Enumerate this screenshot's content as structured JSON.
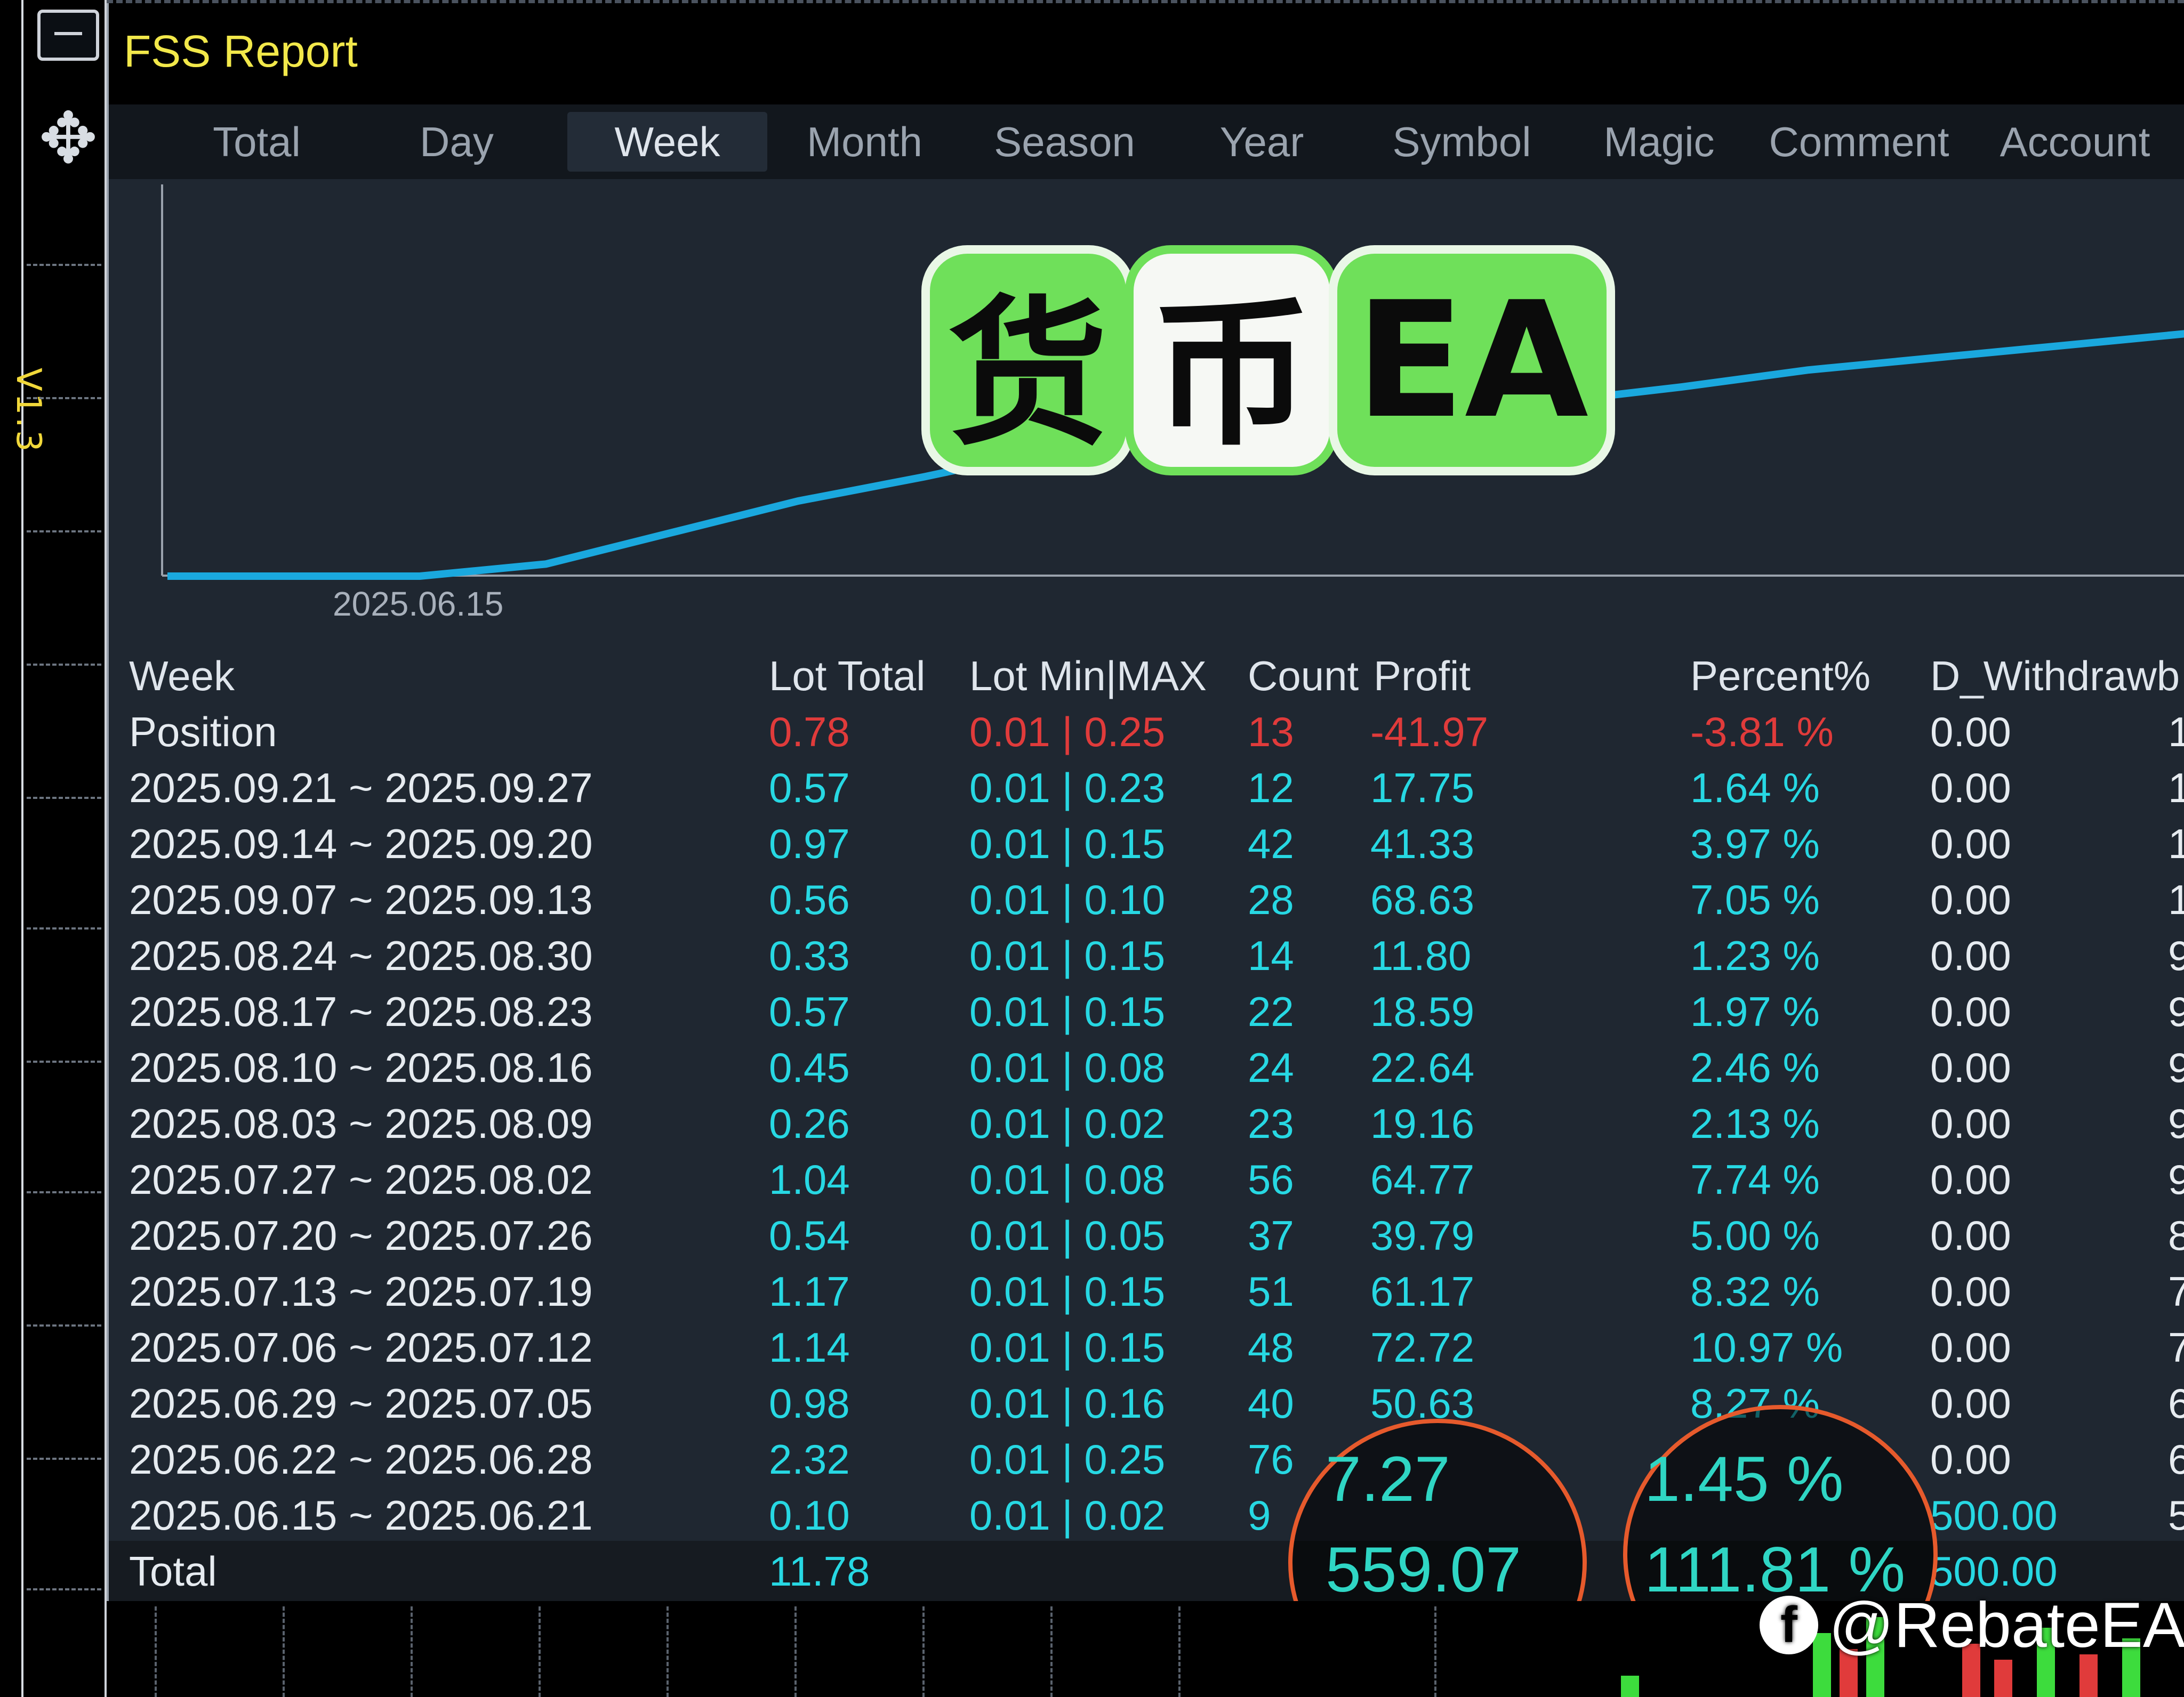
{
  "window": {
    "title": "FSS Report",
    "version_label": "V1.3"
  },
  "tabs": [
    {
      "label": "Total",
      "active": false
    },
    {
      "label": "Day",
      "active": false
    },
    {
      "label": "Week",
      "active": true
    },
    {
      "label": "Month",
      "active": false
    },
    {
      "label": "Season",
      "active": false
    },
    {
      "label": "Year",
      "active": false
    },
    {
      "label": "Symbol",
      "active": false
    },
    {
      "label": "Magic",
      "active": false
    },
    {
      "label": "Comment",
      "active": false
    },
    {
      "label": "Account",
      "active": false
    }
  ],
  "chart_data": {
    "type": "line",
    "x_start_label": "2025.06.15",
    "series": [
      {
        "color": "#1aa8de",
        "values": [
          0,
          0,
          0,
          0.05,
          0.18,
          0.31,
          0.41,
          0.52,
          0.58,
          0.62,
          0.67,
          0.72,
          0.78,
          0.85,
          0.9,
          0.95,
          1.0
        ]
      }
    ]
  },
  "overlay_stamp": {
    "text_1": "货",
    "text_2": "币",
    "text_3": "EA"
  },
  "table": {
    "headers": [
      "Week",
      "Lot Total",
      "Lot Min|MAX",
      "Count",
      "Profit",
      "Percent%",
      "D_Withdrawb"
    ],
    "position_row": {
      "label": "Position",
      "lot_total": "0.78",
      "lot_minmax": "0.01 | 0.25",
      "count": "13",
      "profit": "-41.97",
      "percent": "-3.81 %",
      "withdraw": "0.00",
      "last": "1"
    },
    "rows": [
      {
        "week": "2025.09.21 ~ 2025.09.27",
        "lot_total": "0.57",
        "lot_minmax": "0.01 | 0.23",
        "count": "12",
        "profit": "17.75",
        "percent": "1.64 %",
        "withdraw": "0.00",
        "last": "1"
      },
      {
        "week": "2025.09.14 ~ 2025.09.20",
        "lot_total": "0.97",
        "lot_minmax": "0.01 | 0.15",
        "count": "42",
        "profit": "41.33",
        "percent": "3.97 %",
        "withdraw": "0.00",
        "last": "1"
      },
      {
        "week": "2025.09.07 ~ 2025.09.13",
        "lot_total": "0.56",
        "lot_minmax": "0.01 | 0.10",
        "count": "28",
        "profit": "68.63",
        "percent": "7.05 %",
        "withdraw": "0.00",
        "last": "1"
      },
      {
        "week": "2025.08.24 ~ 2025.08.30",
        "lot_total": "0.33",
        "lot_minmax": "0.01 | 0.15",
        "count": "14",
        "profit": "11.80",
        "percent": "1.23 %",
        "withdraw": "0.00",
        "last": "9"
      },
      {
        "week": "2025.08.17 ~ 2025.08.23",
        "lot_total": "0.57",
        "lot_minmax": "0.01 | 0.15",
        "count": "22",
        "profit": "18.59",
        "percent": "1.97 %",
        "withdraw": "0.00",
        "last": "9"
      },
      {
        "week": "2025.08.10 ~ 2025.08.16",
        "lot_total": "0.45",
        "lot_minmax": "0.01 | 0.08",
        "count": "24",
        "profit": "22.64",
        "percent": "2.46 %",
        "withdraw": "0.00",
        "last": "9"
      },
      {
        "week": "2025.08.03 ~ 2025.08.09",
        "lot_total": "0.26",
        "lot_minmax": "0.01 | 0.02",
        "count": "23",
        "profit": "19.16",
        "percent": "2.13 %",
        "withdraw": "0.00",
        "last": "9"
      },
      {
        "week": "2025.07.27 ~ 2025.08.02",
        "lot_total": "1.04",
        "lot_minmax": "0.01 | 0.08",
        "count": "56",
        "profit": "64.77",
        "percent": "7.74 %",
        "withdraw": "0.00",
        "last": "9"
      },
      {
        "week": "2025.07.20 ~ 2025.07.26",
        "lot_total": "0.54",
        "lot_minmax": "0.01 | 0.05",
        "count": "37",
        "profit": "39.79",
        "percent": "5.00 %",
        "withdraw": "0.00",
        "last": "8"
      },
      {
        "week": "2025.07.13 ~ 2025.07.19",
        "lot_total": "1.17",
        "lot_minmax": "0.01 | 0.15",
        "count": "51",
        "profit": "61.17",
        "percent": "8.32 %",
        "withdraw": "0.00",
        "last": "7"
      },
      {
        "week": "2025.07.06 ~ 2025.07.12",
        "lot_total": "1.14",
        "lot_minmax": "0.01 | 0.15",
        "count": "48",
        "profit": "72.72",
        "percent": "10.97 %",
        "withdraw": "0.00",
        "last": "7"
      },
      {
        "week": "2025.06.29 ~ 2025.07.05",
        "lot_total": "0.98",
        "lot_minmax": "0.01 | 0.16",
        "count": "40",
        "profit": "50.63",
        "percent": "8.27 %",
        "withdraw": "0.00",
        "last": "6"
      },
      {
        "week": "2025.06.22 ~ 2025.06.28",
        "lot_total": "2.32",
        "lot_minmax": "0.01 | 0.25",
        "count": "76",
        "profit": "7.27",
        "percent": "1.45 %",
        "withdraw": "0.00",
        "last": "6"
      },
      {
        "week": "2025.06.15 ~ 2025.06.21",
        "lot_total": "0.10",
        "lot_minmax": "0.01 | 0.02",
        "count": "9",
        "profit": "",
        "percent": "",
        "withdraw": "500.00",
        "last": "5"
      }
    ],
    "total_row": {
      "label": "Total",
      "lot_total": "11.78",
      "profit": "559.07",
      "percent": "111.81 %",
      "withdraw": "500.00"
    }
  },
  "highlights": {
    "profit_partial": "7.27",
    "profit_total": "559.07",
    "percent_partial": "1.45 %",
    "percent_total": "111.81 %"
  },
  "watermark": {
    "text": "@RebateEA",
    "icon": "facebook-icon"
  },
  "colors": {
    "accent_cyan": "#27d8e3",
    "negative_red": "#e03b3b",
    "title_yellow": "#f2e84a",
    "highlight_orange": "#e65a2c",
    "stamp_green": "#6fe05a"
  }
}
